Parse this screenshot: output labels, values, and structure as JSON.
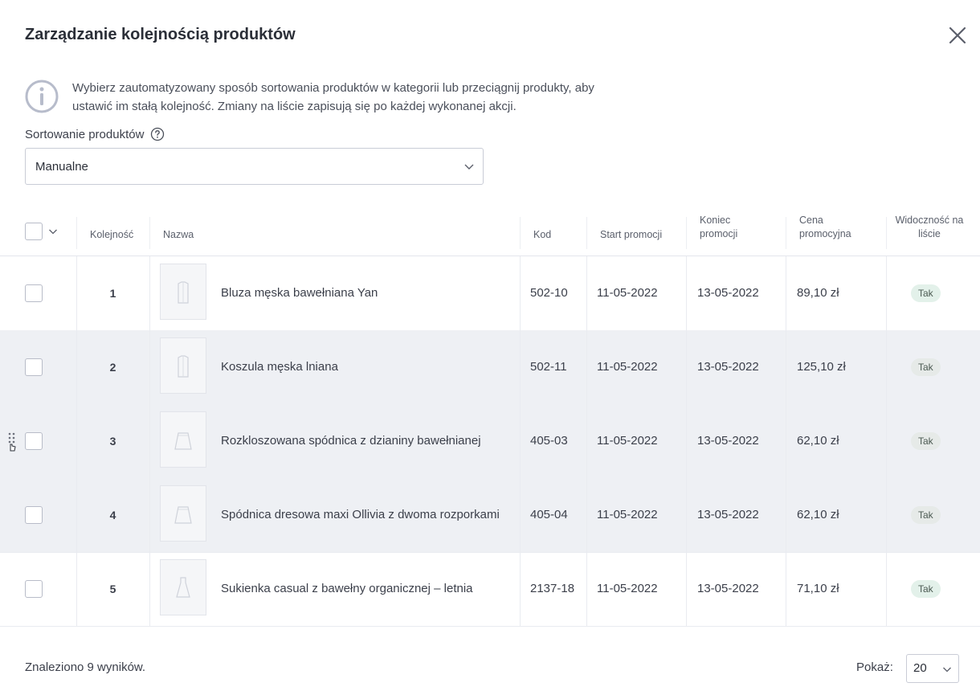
{
  "modal": {
    "title": "Zarządzanie kolejnością produktów",
    "info": "Wybierz zautomatyzowany sposób sortowania produktów w kategorii lub przeciągnij produkty, aby ustawić im stałą kolejność. Zmiany na liście zapisują się po każdej wykonanej akcji.",
    "sort_label": "Sortowanie produktów",
    "sort_value": "Manualne"
  },
  "table": {
    "headers": {
      "order": "Kolejność",
      "name": "Nazwa",
      "code": "Kod",
      "start": "Start promocji",
      "end": "Koniec promocji",
      "price": "Cena promocyjna",
      "visibility": "Widoczność na liście"
    },
    "rows": [
      {
        "order": "1",
        "name": "Bluza męska bawełniana Yan",
        "code": "502-10",
        "start": "11-05-2022",
        "end": "13-05-2022",
        "price": "89,10 zł",
        "visible": "Tak",
        "thumb": "shirt-icon"
      },
      {
        "order": "2",
        "name": "Koszula męska lniana",
        "code": "502-11",
        "start": "11-05-2022",
        "end": "13-05-2022",
        "price": "125,10 zł",
        "visible": "Tak",
        "thumb": "shirt-icon"
      },
      {
        "order": "3",
        "name": "Rozkloszowana spódnica z dzianiny bawełnianej",
        "code": "405-03",
        "start": "11-05-2022",
        "end": "13-05-2022",
        "price": "62,10 zł",
        "visible": "Tak",
        "thumb": "skirt-icon"
      },
      {
        "order": "4",
        "name": "Spódnica dresowa maxi Ollivia z dwoma rozporkami",
        "code": "405-04",
        "start": "11-05-2022",
        "end": "13-05-2022",
        "price": "62,10 zł",
        "visible": "Tak",
        "thumb": "skirt-icon"
      },
      {
        "order": "5",
        "name": "Sukienka casual z bawełny organicznej – letnia",
        "code": "2137-18",
        "start": "11-05-2022",
        "end": "13-05-2022",
        "price": "71,10 zł",
        "visible": "Tak",
        "thumb": "dress-icon"
      }
    ]
  },
  "footer": {
    "found": "Znaleziono 9 wyników.",
    "show_label": "Pokaż:",
    "per_page": "20"
  }
}
